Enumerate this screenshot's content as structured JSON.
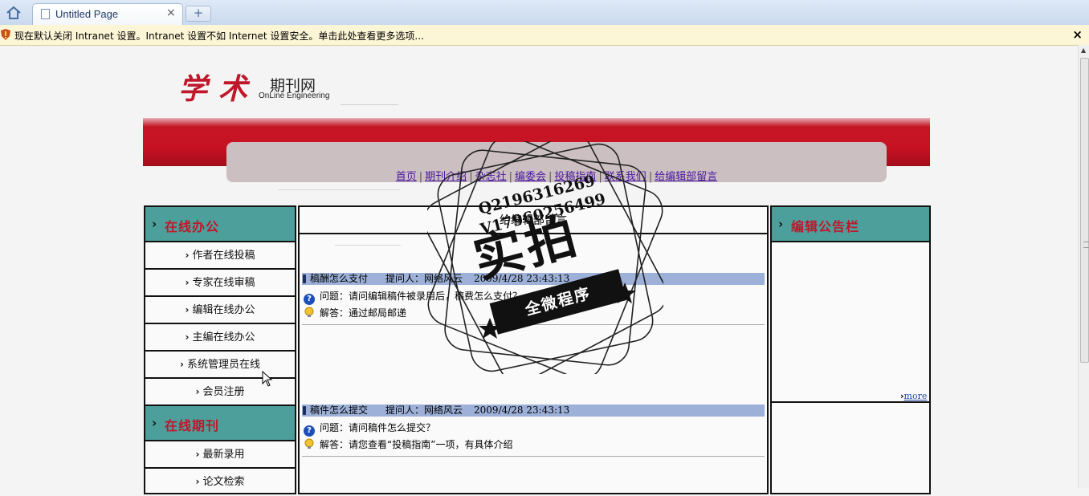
{
  "browser": {
    "tab_title": "Untitled Page",
    "tab_close": "×",
    "new_tab": "+",
    "infobar_text": "现在默认关闭 Intranet 设置。Intranet 设置不如 Internet 设置安全。单击此处查看更多选项...",
    "infobar_close": "×"
  },
  "logo": {
    "name_cn": "学术",
    "name_suffix": "期刊网",
    "name_en": "OnLine Engineering"
  },
  "nav": {
    "items": [
      "首页",
      "期刊介绍",
      "杂志社",
      "编委会",
      "投稿指南",
      "联系我们",
      "给编辑部留言"
    ],
    "separator": "|"
  },
  "left_sidebar": {
    "section1_title": "在线办公",
    "section1_items": [
      "作者在线投稿",
      "专家在线审稿",
      "编辑在线办公",
      "主编在线办公",
      "系统管理员在线",
      "会员注册"
    ],
    "section2_title": "在线期刊",
    "section2_items": [
      "最新录用",
      "论文检索"
    ]
  },
  "main": {
    "title": "给编辑部留言",
    "question_label": "问题：",
    "answer_label": "解答：",
    "entries": [
      {
        "subject": "稿酬怎么支付",
        "asker": "提问人：网络风云",
        "date": "2009/4/28 23:43:13",
        "question": "请问编辑稿件被录用后，稿费怎么支付？",
        "answer": "通过邮局邮递"
      },
      {
        "subject": "稿件怎么提交",
        "asker": "提问人：网络风云",
        "date": "2009/4/28 23:43:13",
        "question": "请问稿件怎么提交？",
        "answer": "请您查看“投稿指南”一项，有具体介绍"
      }
    ]
  },
  "right_sidebar": {
    "title": "编辑公告栏",
    "more_label": "more"
  },
  "watermark": {
    "line1": "Q2196316269",
    "line2": "V17960256499",
    "big_text": "实拍",
    "ribbon_text": "全微程序"
  },
  "colors": {
    "banner_red": "#c81224",
    "section_teal": "#4d9f9c",
    "section_title_red": "#c0172a",
    "qa_bar": "#9cb0d8",
    "link_purple": "#4b17a0"
  }
}
